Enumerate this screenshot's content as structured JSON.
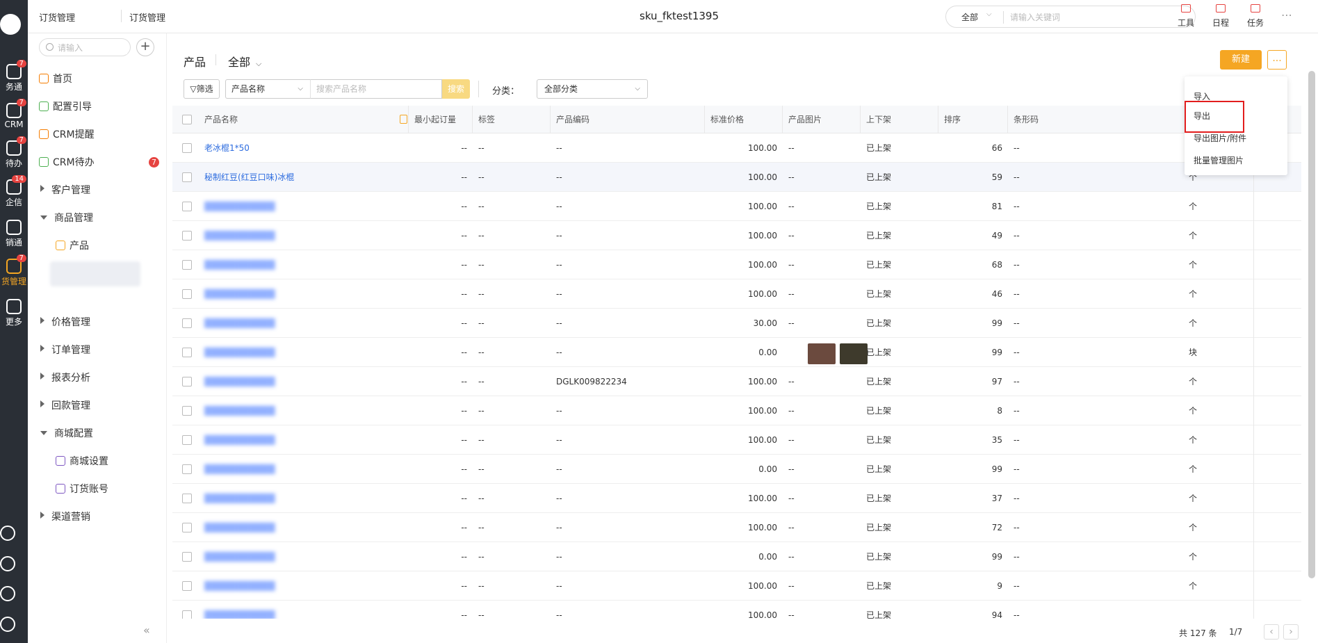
{
  "rail": {
    "items": [
      {
        "label": "务通",
        "badge": "7",
        "icon": "task-icon"
      },
      {
        "label": "CRM",
        "badge": "7",
        "icon": "crm-icon"
      },
      {
        "label": "待办",
        "badge": "7",
        "icon": "todo-icon"
      },
      {
        "label": "企信",
        "badge": "14",
        "icon": "chat-icon"
      },
      {
        "label": "销通",
        "badge": "",
        "icon": "broadcast-icon"
      },
      {
        "label": "货管理",
        "badge": "7",
        "icon": "box-icon"
      },
      {
        "label": "更多",
        "badge": "",
        "icon": "grid-icon"
      }
    ],
    "bottom_icons": [
      "help-icon",
      "clock-icon",
      "settings-icon",
      "user-icon"
    ]
  },
  "topbar": {
    "crumb1": "订货管理",
    "crumb2": "订货管理",
    "title": "sku_fktest1395",
    "search_scope": "全部",
    "search_placeholder": "请输入关键词",
    "tools": [
      "工具",
      "日程",
      "任务"
    ]
  },
  "sidebar": {
    "search_placeholder": "请输入",
    "items": [
      {
        "label": "首页",
        "type": "link",
        "icon": "home-icon",
        "color": "#f57c00"
      },
      {
        "label": "配置引导",
        "type": "link",
        "icon": "guide-icon",
        "color": "#4caf50"
      },
      {
        "label": "CRM提醒",
        "type": "link",
        "icon": "bell-icon",
        "color": "#f57c00"
      },
      {
        "label": "CRM待办",
        "type": "link",
        "icon": "check-icon",
        "color": "#4caf50",
        "badge": "7"
      },
      {
        "label": "客户管理",
        "type": "group"
      },
      {
        "label": "商品管理",
        "type": "group-open"
      },
      {
        "label": "产品",
        "type": "child-active",
        "icon": "cube-icon",
        "color": "#f5a623"
      },
      {
        "label": "价格管理",
        "type": "group"
      },
      {
        "label": "订单管理",
        "type": "group"
      },
      {
        "label": "报表分析",
        "type": "group"
      },
      {
        "label": "回款管理",
        "type": "group"
      },
      {
        "label": "商城配置",
        "type": "group-open"
      },
      {
        "label": "商城设置",
        "type": "child",
        "icon": "gear-icon",
        "color": "#7e57c2"
      },
      {
        "label": "订货账号",
        "type": "child",
        "icon": "account-icon",
        "color": "#7e57c2"
      },
      {
        "label": "渠道营销",
        "type": "group"
      }
    ]
  },
  "main": {
    "title": "产品",
    "scope": "全部",
    "new_button": "新建",
    "more_button": "...",
    "filter_button": "筛选",
    "field_select": "产品名称",
    "search_placeholder": "搜索产品名称",
    "search_button": "搜索",
    "category_label": "分类：",
    "category_select": "全部分类"
  },
  "table": {
    "columns": [
      "产品名称",
      "最小起订量",
      "标签",
      "产品编码",
      "标准价格",
      "产品图片",
      "上下架",
      "排序",
      "条形码"
    ],
    "rows": [
      {
        "name": "老冰棍1*50",
        "moq": "--",
        "tag": "--",
        "code": "--",
        "price": "100.00",
        "img": "--",
        "status": "已上架",
        "sort": "66",
        "barcode": "--",
        "unit": ""
      },
      {
        "name": "秘制红豆(红豆口味)冰棍",
        "moq": "--",
        "tag": "--",
        "code": "--",
        "price": "100.00",
        "img": "--",
        "status": "已上架",
        "sort": "59",
        "barcode": "--",
        "unit": "个"
      },
      {
        "name": "",
        "moq": "--",
        "tag": "--",
        "code": "--",
        "price": "100.00",
        "img": "--",
        "status": "已上架",
        "sort": "81",
        "barcode": "--",
        "unit": "个"
      },
      {
        "name": "",
        "moq": "--",
        "tag": "--",
        "code": "--",
        "price": "100.00",
        "img": "--",
        "status": "已上架",
        "sort": "49",
        "barcode": "--",
        "unit": "个"
      },
      {
        "name": "",
        "moq": "--",
        "tag": "--",
        "code": "--",
        "price": "100.00",
        "img": "--",
        "status": "已上架",
        "sort": "68",
        "barcode": "--",
        "unit": "个"
      },
      {
        "name": "",
        "moq": "--",
        "tag": "--",
        "code": "--",
        "price": "100.00",
        "img": "--",
        "status": "已上架",
        "sort": "46",
        "barcode": "--",
        "unit": "个"
      },
      {
        "name": "",
        "moq": "--",
        "tag": "--",
        "code": "--",
        "price": "30.00",
        "img": "--",
        "status": "已上架",
        "sort": "99",
        "barcode": "--",
        "unit": "个"
      },
      {
        "name": "",
        "moq": "--",
        "tag": "--",
        "code": "--",
        "price": "0.00",
        "img": "images",
        "status": "已上架",
        "sort": "99",
        "barcode": "--",
        "unit": "块"
      },
      {
        "name": "",
        "moq": "--",
        "tag": "--",
        "code": "DGLK009822234",
        "price": "100.00",
        "img": "--",
        "status": "已上架",
        "sort": "97",
        "barcode": "--",
        "unit": "个"
      },
      {
        "name": "",
        "moq": "--",
        "tag": "--",
        "code": "--",
        "price": "100.00",
        "img": "--",
        "status": "已上架",
        "sort": "8",
        "barcode": "--",
        "unit": "个"
      },
      {
        "name": "",
        "moq": "--",
        "tag": "--",
        "code": "--",
        "price": "100.00",
        "img": "--",
        "status": "已上架",
        "sort": "35",
        "barcode": "--",
        "unit": "个"
      },
      {
        "name": "",
        "moq": "--",
        "tag": "--",
        "code": "--",
        "price": "0.00",
        "img": "--",
        "status": "已上架",
        "sort": "99",
        "barcode": "--",
        "unit": "个"
      },
      {
        "name": "",
        "moq": "--",
        "tag": "--",
        "code": "--",
        "price": "100.00",
        "img": "--",
        "status": "已上架",
        "sort": "37",
        "barcode": "--",
        "unit": "个"
      },
      {
        "name": "",
        "moq": "--",
        "tag": "--",
        "code": "--",
        "price": "100.00",
        "img": "--",
        "status": "已上架",
        "sort": "72",
        "barcode": "--",
        "unit": "个"
      },
      {
        "name": "",
        "moq": "--",
        "tag": "--",
        "code": "--",
        "price": "0.00",
        "img": "--",
        "status": "已上架",
        "sort": "99",
        "barcode": "--",
        "unit": "个"
      },
      {
        "name": "",
        "moq": "--",
        "tag": "--",
        "code": "--",
        "price": "100.00",
        "img": "--",
        "status": "已上架",
        "sort": "9",
        "barcode": "--",
        "unit": "个"
      },
      {
        "name": "",
        "moq": "--",
        "tag": "--",
        "code": "--",
        "price": "100.00",
        "img": "--",
        "status": "已上架",
        "sort": "94",
        "barcode": "--",
        "unit": ""
      }
    ]
  },
  "pager": {
    "total": "共 127 条",
    "page": "1/7"
  },
  "dropdown": {
    "items": [
      "导入",
      "导出",
      "导出图片/附件",
      "批量管理图片"
    ]
  }
}
